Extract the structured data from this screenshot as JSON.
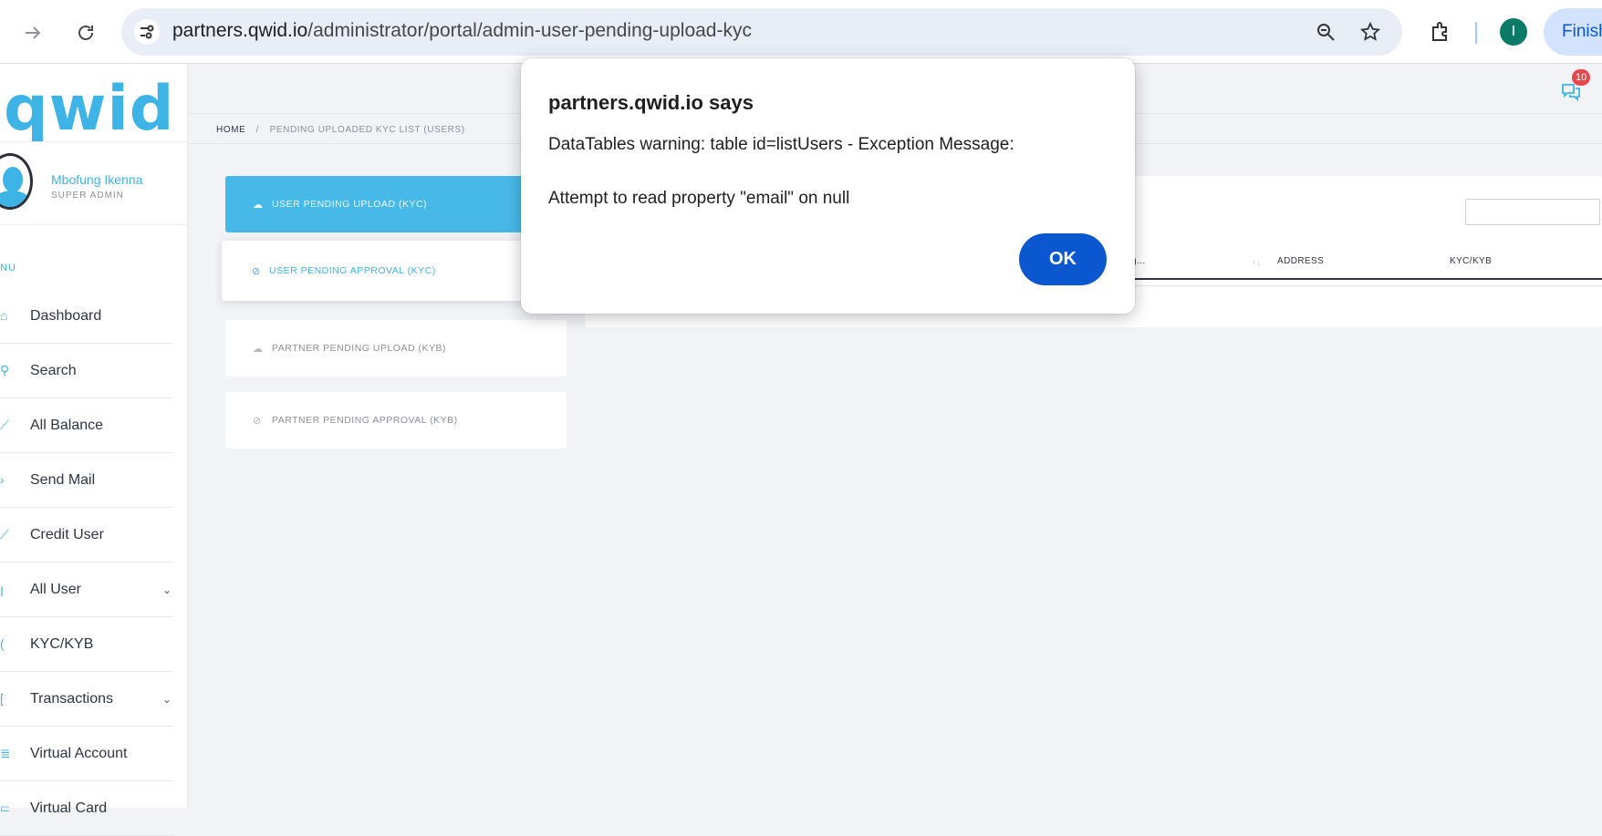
{
  "browser": {
    "url_host": "partners.qwid.io",
    "url_path": "/administrator/portal/admin-user-pending-upload-kyc",
    "profile_initial": "I",
    "finish_label": "Finish"
  },
  "sidebar": {
    "logo": "qwid",
    "user_name": "Mbofung Ikenna",
    "user_role": "SUPER ADMIN",
    "menu_label": "NU",
    "items": [
      {
        "label": "Dashboard",
        "chevron": false
      },
      {
        "label": "Search",
        "chevron": false
      },
      {
        "label": "All Balance",
        "chevron": false
      },
      {
        "label": "Send Mail",
        "chevron": false
      },
      {
        "label": "Credit User",
        "chevron": false
      },
      {
        "label": "All User",
        "chevron": true
      },
      {
        "label": "KYC/KYB",
        "chevron": false
      },
      {
        "label": "Transactions",
        "chevron": true
      },
      {
        "label": "Virtual Account",
        "chevron": false
      },
      {
        "label": "Virtual Card",
        "chevron": false
      }
    ]
  },
  "header": {
    "notification_count": "10"
  },
  "breadcrumb": {
    "home": "HOME",
    "separator": "/",
    "current": "PENDING UPLOADED KYC LIST (USERS)"
  },
  "tabs": [
    {
      "label": "USER PENDING UPLOAD (KYC)",
      "state": "active"
    },
    {
      "label": "USER PENDING APPROVAL (KYC)",
      "state": "hover"
    },
    {
      "label": "PARTNER PENDING UPLOAD (KYB)",
      "state": "normal"
    },
    {
      "label": "PARTNER PENDING APPROVAL (KYB)",
      "state": "normal"
    }
  ],
  "table": {
    "columns": [
      "g...",
      "ADDRESS",
      "KYC/KYB"
    ]
  },
  "dialog": {
    "title": "partners.qwid.io says",
    "message_line1": "DataTables warning: table id=listUsers - Exception Message:",
    "message_line2": "Attempt to read property \"email\" on null",
    "ok_label": "OK"
  },
  "colors": {
    "brand": "#3db4e5",
    "active_tab": "#47b9e9",
    "dialog_button": "#0b57d0",
    "badge": "#e5484d"
  }
}
